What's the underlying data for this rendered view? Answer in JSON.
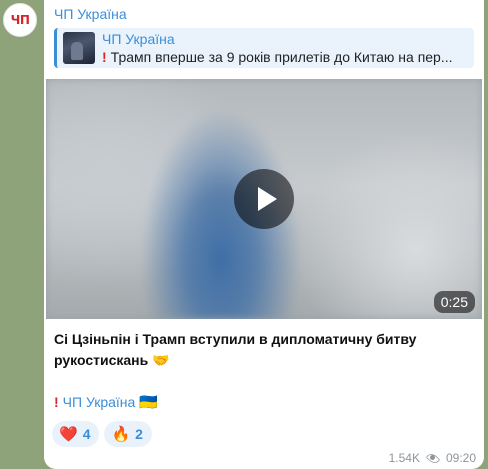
{
  "channel": {
    "avatar_text": "ЧП",
    "name": "ЧП Україна"
  },
  "reply": {
    "name": "ЧП Україна",
    "text": "Трамп вперше за 9 років прилетів до Китаю на пер..."
  },
  "video": {
    "duration": "0:25"
  },
  "caption": "Сі Цзіньпін і Трамп вступили в дипломатичну битву рукостискань 🤝",
  "signature": {
    "bang": "❗",
    "link_text": "ЧП Україна",
    "flag": "🇺🇦"
  },
  "reactions": [
    {
      "emoji": "❤️",
      "icon": "heart-icon",
      "count": "4"
    },
    {
      "emoji": "🔥",
      "icon": "fire-icon",
      "count": "2"
    }
  ],
  "meta": {
    "views": "1.54K",
    "time": "09:20"
  },
  "colors": {
    "accent": "#3a8ed8",
    "background": "#8fa37a",
    "reaction_bg": "#e9f2fb"
  }
}
